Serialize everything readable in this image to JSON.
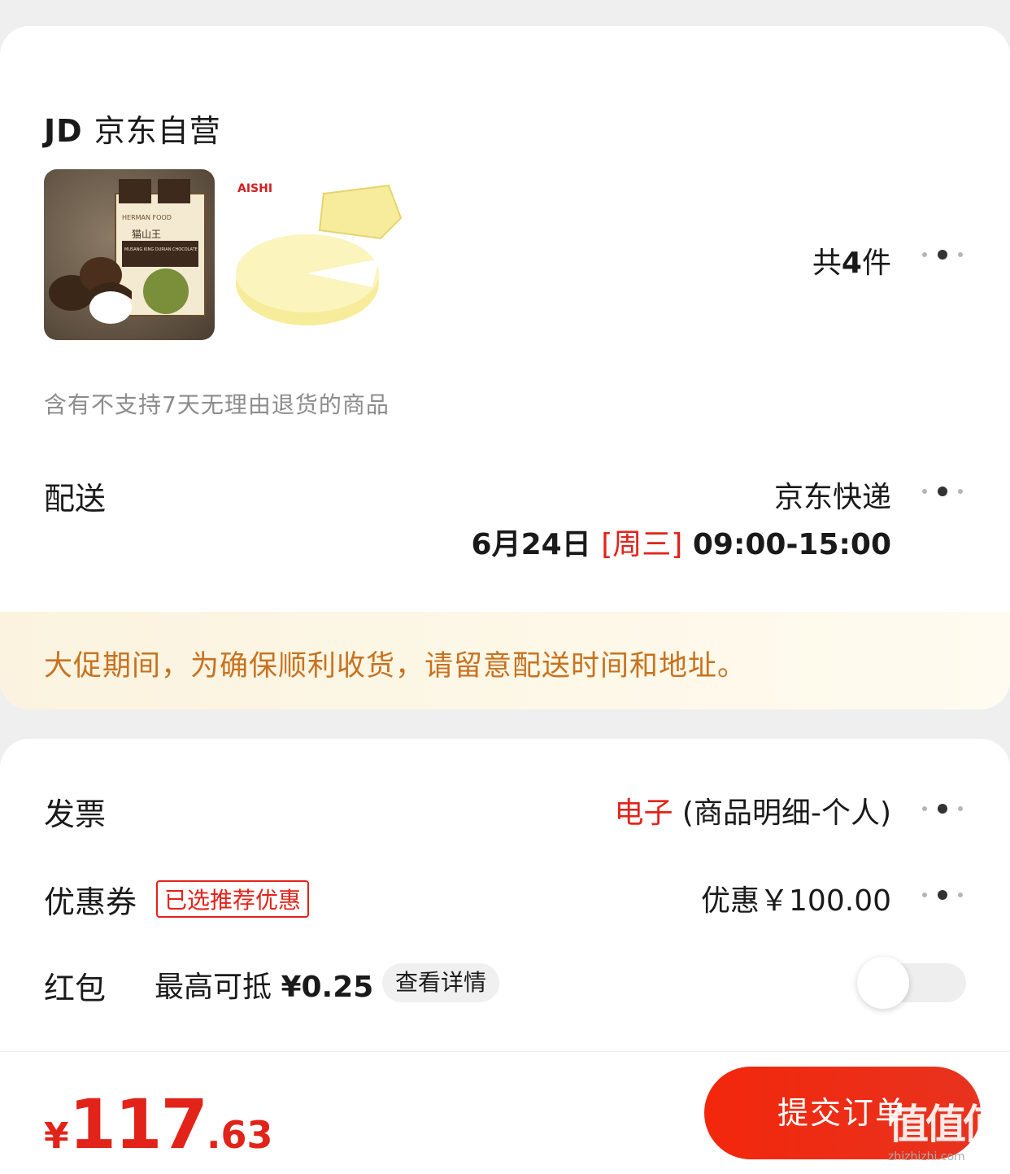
{
  "shop": {
    "logo": "JD",
    "name": "京东自营"
  },
  "items": {
    "count_prefix": "共",
    "count": "4",
    "count_suffix": "件",
    "chocolate_brand": "HERMAN FOOD",
    "chocolate_name": "猫山王",
    "chocolate_label": "MUSANG KING DURIAN CHOCOLATE",
    "cake_brand": "AISHI"
  },
  "return_notice": "含有不支持7天无理由退货的商品",
  "delivery": {
    "label": "配送",
    "method": "京东快递",
    "date": "6月24日 ",
    "weekday": "[周三]",
    "time": " 09:00-15:00"
  },
  "promo_notice": "大促期间，为确保顺利收货，请留意配送时间和地址。",
  "invoice": {
    "label": "发票",
    "type": "电子",
    "detail": " (商品明细-个人)"
  },
  "coupon": {
    "label": "优惠券",
    "badge": "已选推荐优惠",
    "value": "优惠￥100.00"
  },
  "redpack": {
    "label": "红包",
    "max_prefix": "最高可抵 ",
    "max_value": "¥0.25",
    "detail_button": "查看详情",
    "enabled": false
  },
  "total": {
    "currency": "¥",
    "integer": "117",
    "decimal": ".63"
  },
  "submit_button": "提交订单",
  "watermark": {
    "mark": "值值值",
    "site": "zhizhizhi.com"
  },
  "colors": {
    "brand_red": "#e2231a",
    "promo_orange": "#c8721f",
    "banner_bg": "#fbf3df"
  }
}
